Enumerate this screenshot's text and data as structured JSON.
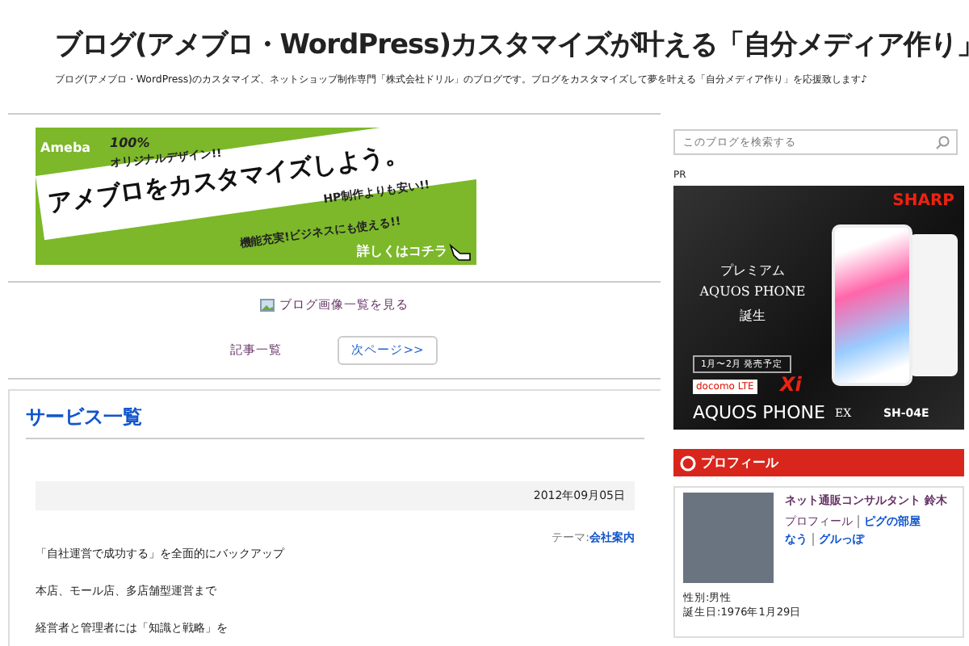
{
  "header": {
    "title": "ブログ(アメブロ・WordPress)カスタマイズが叶える「自分メディア作り」",
    "description": "ブログ(アメブロ・WordPress)のカスタマイズ、ネットショップ制作専門「株式会社ドリル」のブログです。ブログをカスタマイズして夢を叶える「自分メディア作り」を応援致します♪"
  },
  "banner": {
    "logo": "Ameba",
    "lines": [
      "100%",
      "オリジナルデザイン!!",
      "アメブロをカスタマイズしよう。",
      "HP制作よりも安い!!",
      "機能充実!ビジネスにも使える!!"
    ],
    "cta": "詳しくはコチラ"
  },
  "image_list_link": "ブログ画像一覧を見る",
  "pager": {
    "list_link": "記事一覧",
    "next_button": "次ページ>>"
  },
  "article": {
    "title": "サービス一覧",
    "date": "2012年09月05日",
    "theme_label": "テーマ:",
    "theme": "会社案内",
    "paragraphs": [
      "「自社運営で成功する」を全面的にバックアップ",
      "本店、モール店、多店舗型運営まで",
      "経営者と管理者には「知識と戦略」を"
    ]
  },
  "sidebar": {
    "search": {
      "placeholder": "このブログを検索する"
    },
    "pr_label": "PR",
    "ad": {
      "brand": "SHARP",
      "headline": [
        "プレミアム",
        "AQUOS PHONE",
        "誕生"
      ],
      "release": "1月〜2月 発売予定",
      "carrier": "docomo LTE",
      "xi": "Xi",
      "product": "AQUOS PHONE",
      "suffix": "EX",
      "model": "SH-04E"
    },
    "profile": {
      "heading": "プロフィール",
      "name": "ネット通販コンサルタント 鈴木",
      "links": [
        "プロフィール",
        "ピグの部屋",
        "なう",
        "グルっぽ"
      ],
      "facts": [
        "性別:男性",
        "誕生日:1976年1月29日"
      ]
    }
  }
}
